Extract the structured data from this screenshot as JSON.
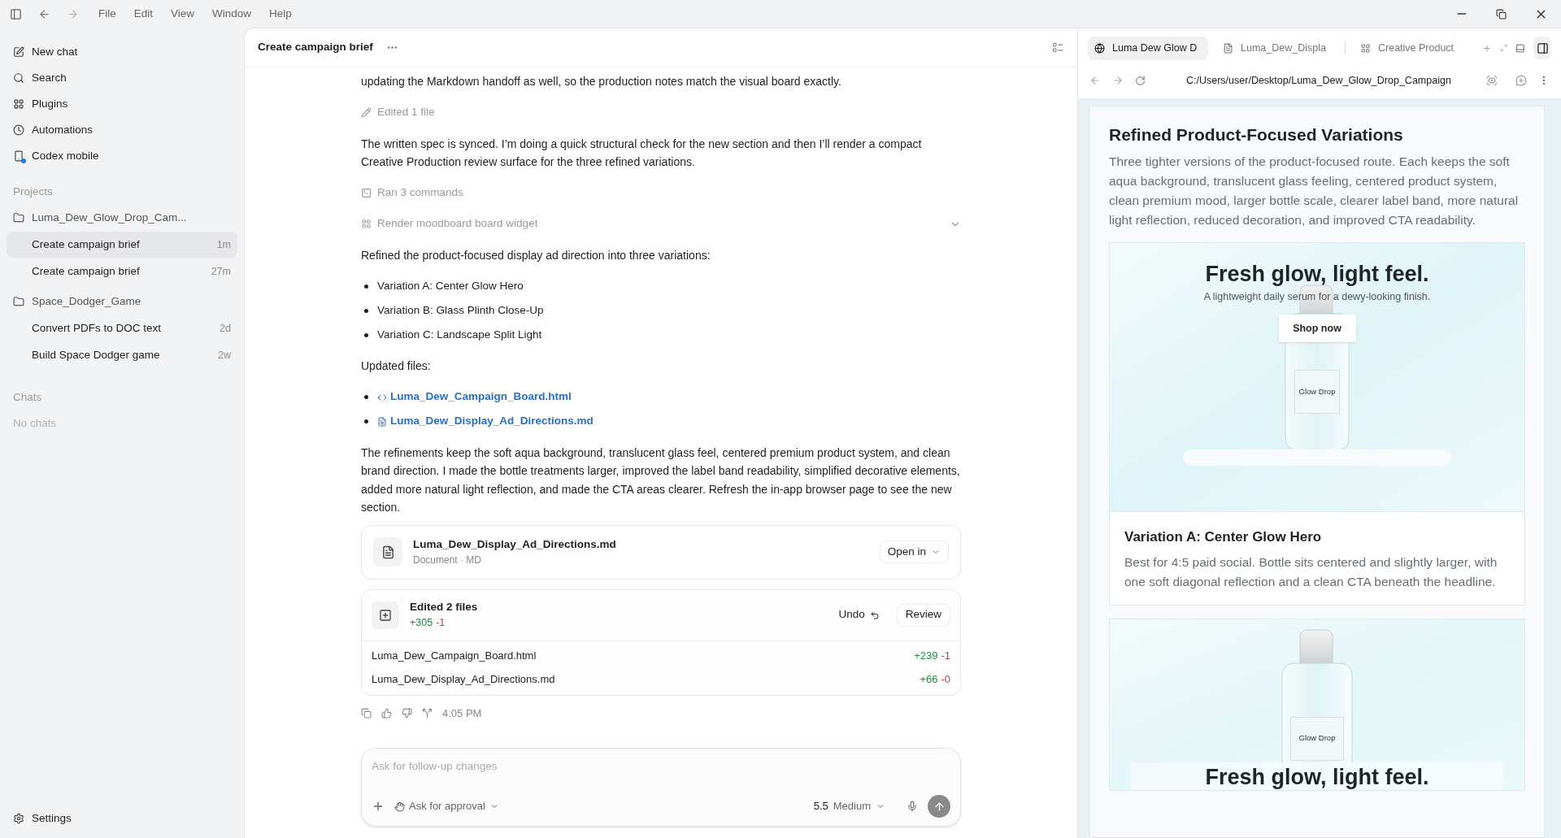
{
  "menu_bar": {
    "items": [
      "File",
      "Edit",
      "View",
      "Window",
      "Help"
    ]
  },
  "sidebar": {
    "nav": [
      {
        "label": "New chat",
        "notification": false
      },
      {
        "label": "Search",
        "notification": false
      },
      {
        "label": "Plugins",
        "notification": false
      },
      {
        "label": "Automations",
        "notification": false
      },
      {
        "label": "Codex mobile",
        "notification": true
      }
    ],
    "projects_heading": "Projects",
    "projects": [
      {
        "name": "Luma_Dew_Glow_Drop_Cam...",
        "chats": [
          {
            "title": "Create campaign brief",
            "age": "1m",
            "selected": true
          },
          {
            "title": "Create campaign brief",
            "age": "27m",
            "selected": false
          }
        ]
      },
      {
        "name": "Space_Dodger_Game",
        "chats": [
          {
            "title": "Convert PDFs to DOC text",
            "age": "2d",
            "selected": false
          },
          {
            "title": "Build Space Dodger game",
            "age": "2w",
            "selected": false
          }
        ]
      }
    ],
    "chats_heading": "Chats",
    "chats_empty": "No chats",
    "settings": "Settings"
  },
  "chat": {
    "title": "Create campaign brief",
    "transcript": [
      {
        "kind": "paragraph",
        "text": "updating the Markdown handoff as well, so the production notes match the visual board exactly."
      },
      {
        "kind": "edit_activity",
        "label": "Edited 1 file"
      },
      {
        "kind": "paragraph",
        "text": "The written spec is synced. I’m doing a quick structural check for the new section and then I’ll render a compact Creative Production review surface for the three refined variations."
      },
      {
        "kind": "command_activity",
        "label": "Ran 3 commands"
      },
      {
        "kind": "widget_activity",
        "label": "Render moodboard board widget",
        "expanded": false
      },
      {
        "kind": "paragraph",
        "text": "Refined the product-focused display ad direction into three variations:"
      },
      {
        "kind": "bullets",
        "items": [
          "Variation A: Center Glow Hero",
          "Variation B: Glass Plinth Close-Up",
          "Variation C: Landscape Split Light"
        ]
      },
      {
        "kind": "paragraph",
        "text": "Updated files:"
      },
      {
        "kind": "file_links",
        "items": [
          {
            "name": "Luma_Dew_Campaign_Board.html",
            "kind": "code"
          },
          {
            "name": "Luma_Dew_Display_Ad_Directions.md",
            "kind": "doc"
          }
        ]
      },
      {
        "kind": "paragraph",
        "text": "The refinements keep the soft aqua background, translucent glass feel, centered premium product system, and clean brand direction. I made the bottle treatments larger, improved the label band readability, simplified decorative elements, added more natural light reflection, and made the CTA areas clearer. Refresh the in-app browser page to see the new section."
      }
    ],
    "file_card": {
      "name": "Luma_Dew_Display_Ad_Directions.md",
      "meta": "Document · MD",
      "button": "Open in"
    },
    "edits_card": {
      "title": "Edited 2 files",
      "added": "+305",
      "removed": "-1",
      "undo": "Undo",
      "review": "Review",
      "files": [
        {
          "name": "Luma_Dew_Campaign_Board.html",
          "added": "+239",
          "removed": "-1"
        },
        {
          "name": "Luma_Dew_Display_Ad_Directions.md",
          "added": "+66",
          "removed": "-0"
        }
      ]
    },
    "time": "4:05 PM",
    "composer": {
      "placeholder": "Ask for follow-up changes",
      "approval": "Ask for approval",
      "model": "5.5",
      "effort": "Medium"
    }
  },
  "browser": {
    "tabs": [
      {
        "title": "Luma Dew Glow D",
        "selected": true
      },
      {
        "title": "Luma_Dew_Displa",
        "selected": false
      },
      {
        "title": "Creative Product",
        "selected": false
      }
    ],
    "url": "C:/Users/user/Desktop/Luma_Dew_Glow_Drop_Campaign",
    "page": {
      "heading": "Refined Product-Focused Variations",
      "intro": "Three tighter versions of the product-focused route. Each keeps the soft aqua background, translucent glass feeling, centered product system, clean premium mood, larger bottle scale, clearer label band, more natural light reflection, reduced decoration, and improved CTA readability.",
      "variations": [
        {
          "kind": "center",
          "headline": "Fresh glow, light feel.",
          "subline": "A lightweight daily serum for a dewy-looking finish.",
          "cta": "Shop now",
          "label": "Glow Drop",
          "title": "Variation A: Center Glow Hero",
          "description": "Best for 4:5 paid social. Bottle sits centered and slightly larger, with one soft diagonal reflection and a clean CTA beneath the headline."
        },
        {
          "kind": "plinth",
          "headline": "Fresh glow, light feel.",
          "label": "Glow Drop"
        }
      ]
    }
  }
}
